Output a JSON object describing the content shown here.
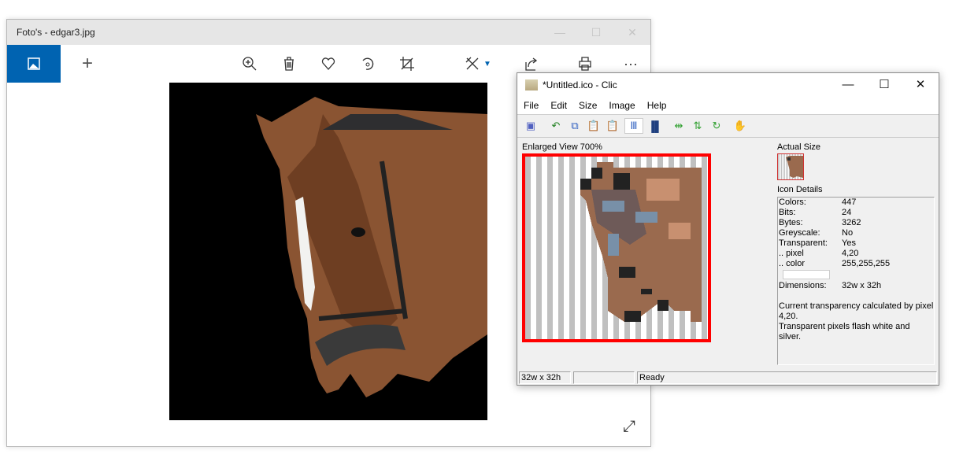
{
  "photos": {
    "title": "Foto's - edgar3.jpg",
    "window_controls": {
      "minimize": "—",
      "maximize": "☐",
      "close": "✕"
    },
    "toolbar": [
      "zoom-in",
      "delete",
      "favorite",
      "rotate",
      "crop",
      "edit-create",
      "share",
      "print",
      "more"
    ],
    "more_label": "···",
    "add_label": "+"
  },
  "clic": {
    "title": "*Untitled.ico - Clic",
    "logo_text": "clic",
    "menu": [
      "File",
      "Edit",
      "Size",
      "Image",
      "Help"
    ],
    "enlarged_label": "Enlarged View 700%",
    "actual_label": "Actual Size",
    "details_label": "Icon Details",
    "details": [
      {
        "k": "Colors:",
        "v": "447"
      },
      {
        "k": "Bits:",
        "v": "24"
      },
      {
        "k": "Bytes:",
        "v": "3262"
      },
      {
        "k": "Greyscale:",
        "v": "No"
      },
      {
        "k": "Transparent:",
        "v": "Yes"
      },
      {
        "k": ".. pixel",
        "v": "4,20"
      },
      {
        "k": ".. color",
        "v": "255,255,255"
      }
    ],
    "transparent_color": "#ffffff",
    "dimensions_key": "Dimensions:",
    "dimensions_val": "32w x 32h",
    "note1": "Current transparency calculated by pixel 4,20.",
    "note2": "Transparent pixels flash white and silver.",
    "status": [
      "32w x 32h",
      "",
      "Ready"
    ]
  }
}
